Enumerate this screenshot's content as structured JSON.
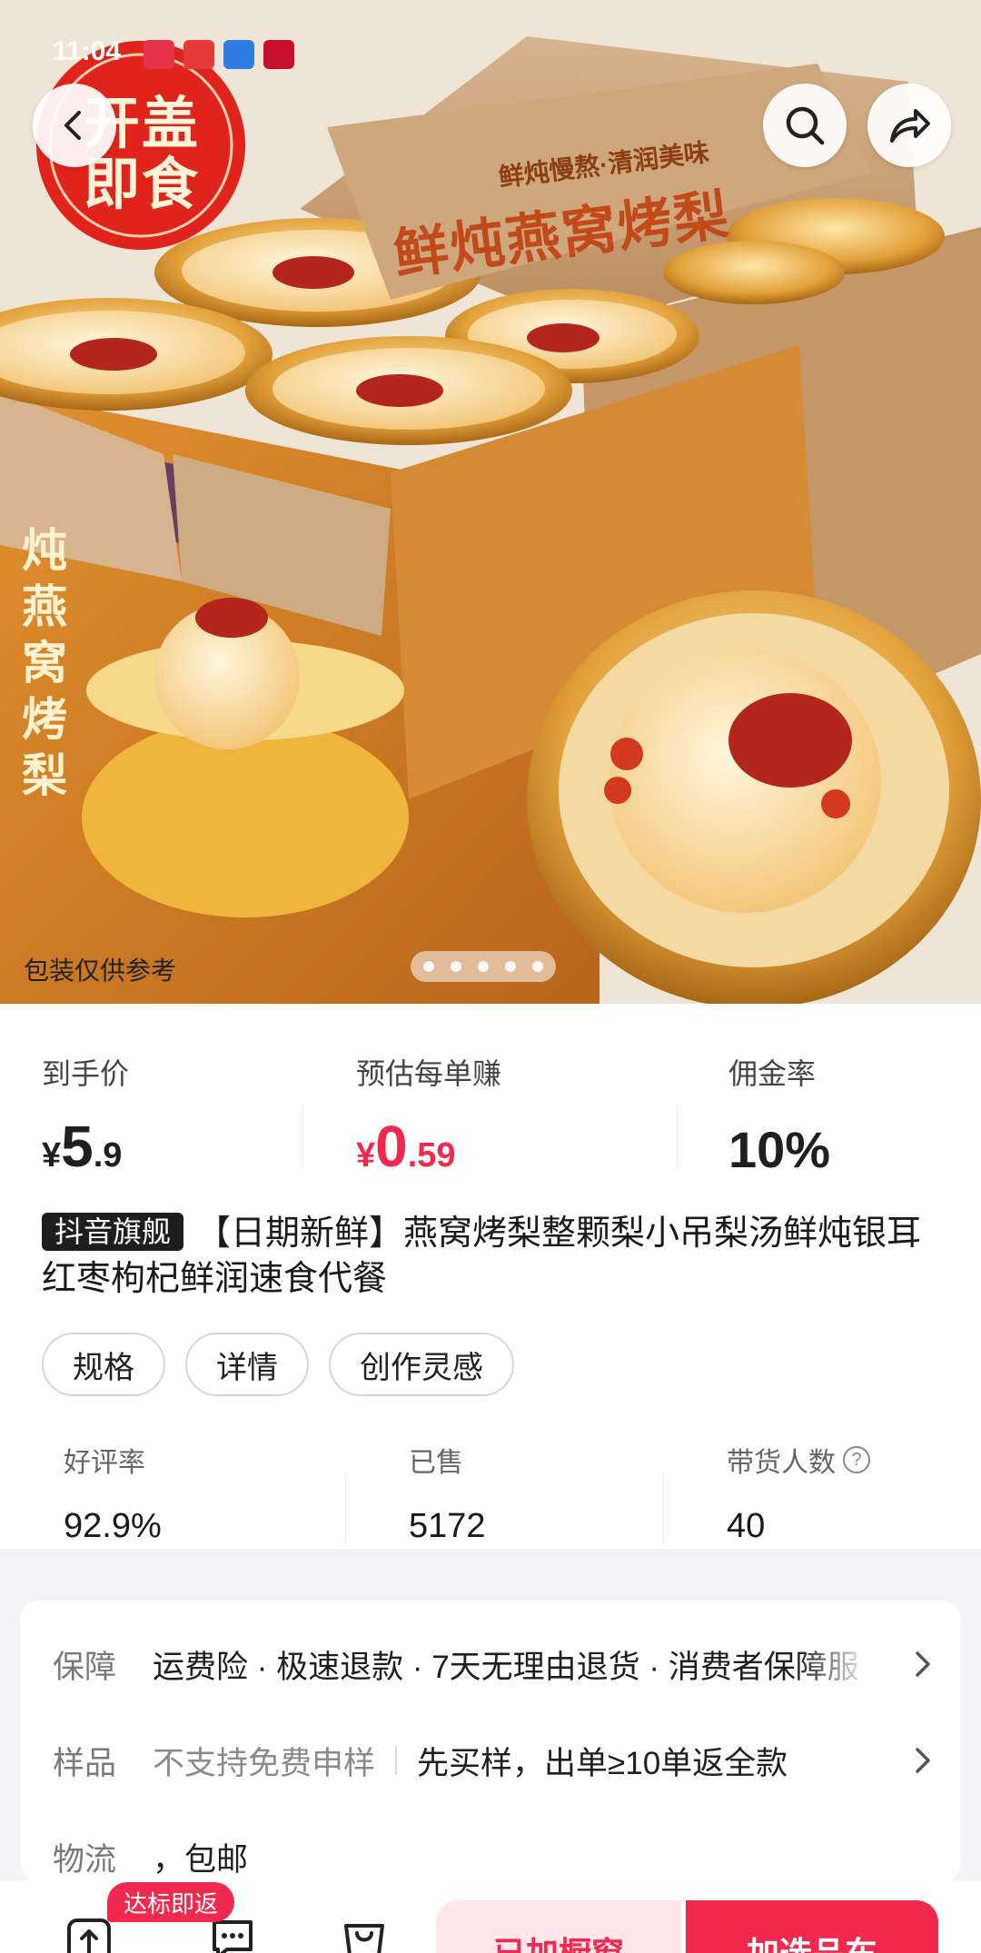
{
  "status": {
    "time": "11:04"
  },
  "hero": {
    "promo_line1": "开盖",
    "promo_line2": "即食",
    "box_tagline": "鲜炖慢熬·清润美味",
    "box_title": "鲜炖燕窝烤梨",
    "box_side_text": "炖燕窝烤梨",
    "disclaimer": "包装仅供参考",
    "slide_total": 5,
    "slide_current": 1
  },
  "prices": {
    "final": {
      "label": "到手价",
      "currency": "¥",
      "int": "5",
      "dec": ".9"
    },
    "earn": {
      "label": "预估每单赚",
      "currency": "¥",
      "int": "0",
      "dec": ".59"
    },
    "commission": {
      "label": "佣金率",
      "value": "10%"
    }
  },
  "product": {
    "badge": "抖音旗舰",
    "title": "【日期新鲜】燕窝烤梨整颗梨小吊梨汤鲜炖银耳红枣枸杞鲜润速食代餐"
  },
  "chips": [
    "规格",
    "详情",
    "创作灵感"
  ],
  "stats": {
    "rating": {
      "label": "好评率",
      "value": "92.9%"
    },
    "sold": {
      "label": "已售",
      "value": "5172"
    },
    "sellers": {
      "label": "带货人数",
      "value": "40"
    }
  },
  "guarantee": {
    "row1": {
      "key": "保障",
      "value": "运费险 · 极速退款 · 7天无理由退货 · 消费者保障服"
    },
    "row2": {
      "key": "样品",
      "value_muted": "不支持免费申样",
      "value": "先买样，出单≥10单返全款"
    },
    "row3": {
      "key": "物流",
      "value": "，包邮"
    }
  },
  "bottom": {
    "rebate_badge": "达标即返",
    "btn_secondary": "已加橱窗",
    "btn_primary": "加选品车"
  },
  "colors": {
    "accent": "#f2294f",
    "accent_soft": "#ffe6ea",
    "badge_dark": "#1e1e1e"
  }
}
